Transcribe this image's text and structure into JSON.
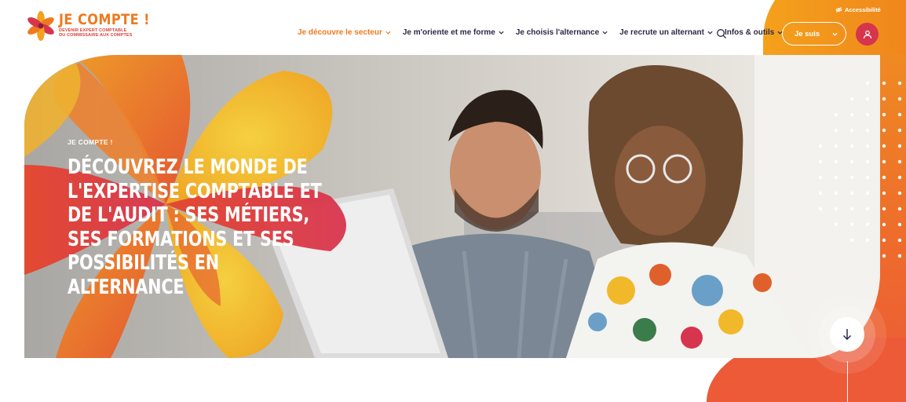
{
  "brand": {
    "title": "JE COMPTE !",
    "subtitle_line1": "DEVENIR EXPERT COMPTABLE",
    "subtitle_line2": "OU COMMISSAIRE AUX COMPTES"
  },
  "nav": {
    "items": [
      {
        "label": "Je découvre le secteur",
        "active": true
      },
      {
        "label": "Je m'oriente et me forme",
        "active": false
      },
      {
        "label": "Je choisis l'alternance",
        "active": false
      },
      {
        "label": "Je recrute un alternant",
        "active": false
      },
      {
        "label": "Infos & outils",
        "active": false
      }
    ],
    "search_icon": "search-icon"
  },
  "utility": {
    "accessibility_label": "Accessibilité",
    "profile_select_label": "Je suis",
    "user_icon": "user-icon"
  },
  "hero": {
    "kicker": "JE COMPTE !",
    "title": "Découvrez le monde de l'expertise comptable et de l'audit : ses métiers, ses formations et ses possibilités en alternance",
    "scroll_icon": "arrow-down-icon"
  },
  "colors": {
    "orange": "#ee7a20",
    "amber": "#f4a11c",
    "red": "#d6354d",
    "navy": "#2a2a4a"
  }
}
